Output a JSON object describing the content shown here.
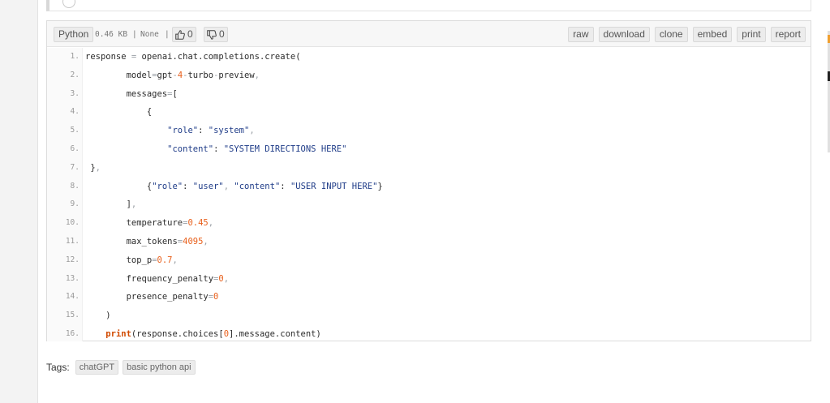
{
  "paste": {
    "language": "Python",
    "size": "0.46 KB",
    "separator1": "|",
    "license": "None",
    "separator2": "|",
    "likes": "0",
    "dislikes": "0",
    "actions": [
      "raw",
      "download",
      "clone",
      "embed",
      "print",
      "report"
    ]
  },
  "code": {
    "line_numbers": [
      "1.",
      "2.",
      "3.",
      "4.",
      "5.",
      "6.",
      "7.",
      "8.",
      "9.",
      "10.",
      "11.",
      "12.",
      "13.",
      "14.",
      "15.",
      "16."
    ]
  },
  "tags": {
    "label": "Tags:",
    "items": [
      "chatGPT",
      "basic python api"
    ]
  },
  "colors": {
    "string": "#1f3c88",
    "number": "#e8601c",
    "keyword": "#d14a00",
    "operator": "#9aa0a6"
  },
  "icons": {
    "like": "thumbs-up-icon",
    "dislike": "thumbs-down-icon"
  }
}
